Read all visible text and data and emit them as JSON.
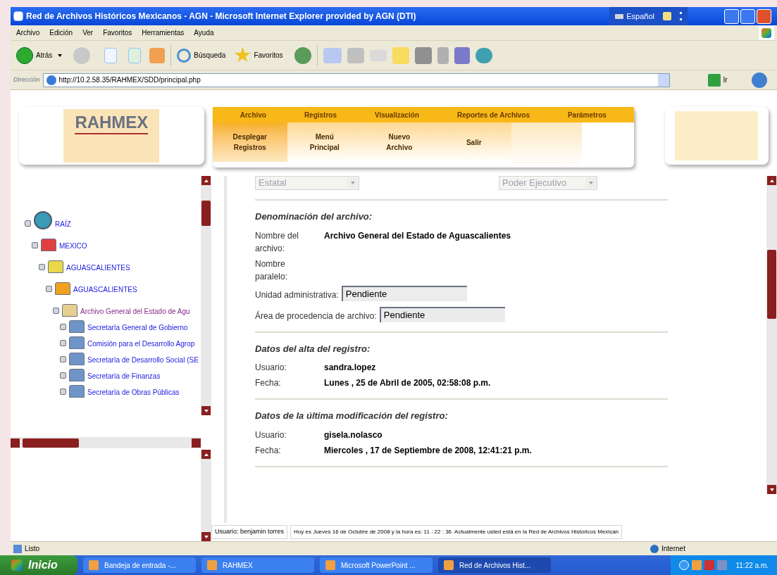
{
  "window": {
    "title": "Red de Archivos Históricos Mexicanos - AGN - Microsoft Internet Explorer provided by AGN (DTI)",
    "language": "Español"
  },
  "menu_bar": [
    "Archivo",
    "Edición",
    "Ver",
    "Favoritos",
    "Herramientas",
    "Ayuda"
  ],
  "toolbar": {
    "back": "Atrás",
    "search": "Búsqueda",
    "favorites": "Favoritos"
  },
  "address_bar": {
    "label": "Dirección",
    "url": "http://10.2.58.35/RAHMEX/SDD/principal.php",
    "go": "Ir"
  },
  "header": {
    "logo": "RAHMEX",
    "top_menu": [
      "Archivo",
      "Registros",
      "Visualización",
      "Reportes de Archivos",
      "Parámetros"
    ],
    "sub_menu": [
      {
        "label": "Desplegar\nRegistros",
        "selected": true
      },
      {
        "label": "Menú\nPrincipal",
        "selected": false
      },
      {
        "label": "Nuevo\nArchivo",
        "selected": false
      },
      {
        "label": "Salir",
        "selected": false
      }
    ]
  },
  "tree": [
    {
      "label": "RAÍZ",
      "kind": "globe",
      "selected": false,
      "children": [
        {
          "label": "MEXICO",
          "kind": "red",
          "selected": false,
          "children": [
            {
              "label": "AGUASCALIENTES",
              "kind": "yellow",
              "selected": false,
              "children": [
                {
                  "label": "AGUASCALIENTES",
                  "kind": "orange",
                  "selected": false,
                  "children": [
                    {
                      "label": "Archivo General del Estado de Agu",
                      "kind": "tan",
                      "selected": true,
                      "children": [
                        {
                          "label": "Secretaría General de Gobierno",
                          "kind": "blue",
                          "selected": false
                        },
                        {
                          "label": "Comisión para el Desarrollo Agrop",
                          "kind": "blue",
                          "selected": false
                        },
                        {
                          "label": "Secretaría de Desarrollo Social (SE",
                          "kind": "blue",
                          "selected": false
                        },
                        {
                          "label": "Secretaría de Finanzas",
                          "kind": "blue",
                          "selected": false
                        },
                        {
                          "label": "Secretaría de Obras Públicas",
                          "kind": "blue",
                          "selected": false
                        }
                      ]
                    }
                  ]
                }
              ]
            }
          ]
        }
      ]
    }
  ],
  "form": {
    "selects": [
      {
        "value": "Estatal",
        "disabled": true
      },
      {
        "value": "Poder Ejecutivo",
        "disabled": true
      }
    ],
    "sections": [
      {
        "title": "Denominación del archivo:",
        "fields": [
          {
            "kind": "text",
            "label": "Nombre del archivo:",
            "value": "Archivo General del Estado de Aguascalientes"
          },
          {
            "kind": "text",
            "label": "Nombre paralelo:"
          },
          {
            "kind": "input",
            "label": "Unidad administrativa:",
            "value": "Pendiente"
          },
          {
            "kind": "input",
            "label": "Área de procedencia de archivo:",
            "value": "Pendiente"
          }
        ]
      },
      {
        "title": "Datos del alta del registro:",
        "fields": [
          {
            "kind": "text",
            "label": "Usuario:",
            "value": "sandra.lopez"
          },
          {
            "kind": "text",
            "label": "Fecha:",
            "value": "Lunes , 25 de Abril de 2005, 02:58:08 p.m."
          }
        ]
      },
      {
        "title": "Datos de la última modificación del registro:",
        "fields": [
          {
            "kind": "text",
            "label": "Usuario:",
            "value": "gisela.nolasco"
          },
          {
            "kind": "text",
            "label": "Fecha:",
            "value": "Miercoles , 17 de Septiembre de 2008, 12:41:21 p.m."
          }
        ]
      }
    ]
  },
  "page_status": {
    "user": "Usuario: benjamin torres",
    "message": "Hoy es Jueves 16 de Octubre de 2008 y la hora es: 11 : 22 : 36  Actualmente usted está en la Red de Archivos Históricos Mexican"
  },
  "status_bar": {
    "text": "Listo",
    "zone": "Internet"
  },
  "taskbar": {
    "start": "Inicio",
    "items": [
      {
        "label": "Bandeja de entrada -...",
        "selected": false
      },
      {
        "label": "RAHMEX",
        "selected": false
      },
      {
        "label": "Microsoft PowerPoint ...",
        "selected": false
      },
      {
        "label": "Red de Archivos Hist...",
        "selected": true
      }
    ],
    "clock": "11:22 a.m."
  }
}
